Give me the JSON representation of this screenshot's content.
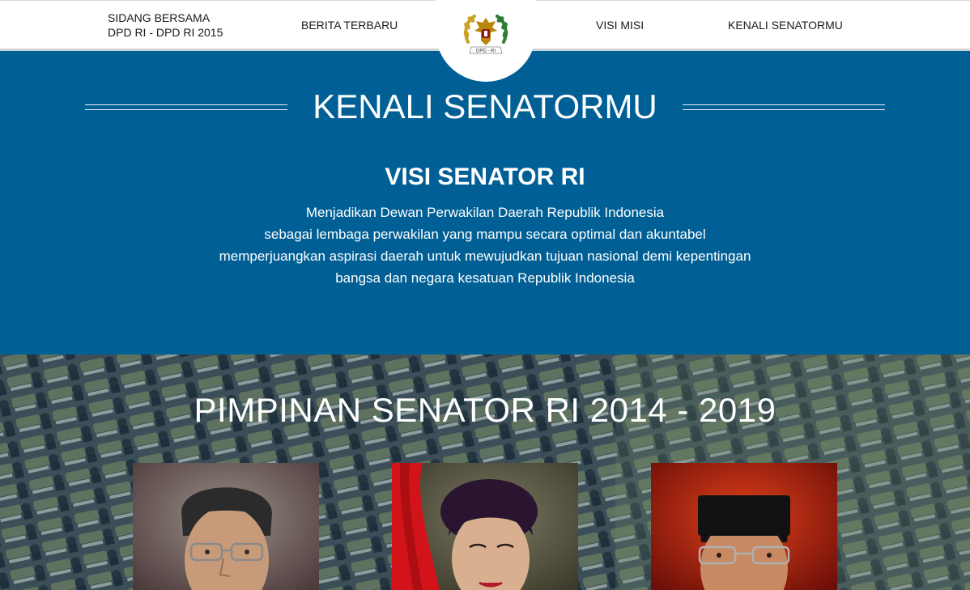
{
  "nav": {
    "sidang_line1": "SIDANG BERSAMA",
    "sidang_line2": "DPD RI - DPD RI 2015",
    "berita": "BERITA TERBARU",
    "visi_misi": "VISI MISI",
    "kenali": "KENALI SENATORMU"
  },
  "logo": {
    "caption": "DPD - RI"
  },
  "hero": {
    "title": "KENALI SENATORMU",
    "visi_heading": "VISI SENATOR RI",
    "visi_lines": [
      "Menjadikan Dewan Perwakilan Daerah Republik Indonesia",
      "sebagai lembaga perwakilan yang mampu secara optimal dan akuntabel",
      "memperjuangkan aspirasi daerah untuk mewujudkan tujuan nasional demi kepentingan",
      "bangsa dan negara kesatuan Republik Indonesia"
    ]
  },
  "pimpinan": {
    "title": "PIMPINAN SENATOR RI 2014 - 2019"
  },
  "colors": {
    "primary_blue": "#005f95",
    "nav_bg": "#ffffff",
    "logo_gold": "#c9a227",
    "logo_green": "#2e7d32"
  }
}
